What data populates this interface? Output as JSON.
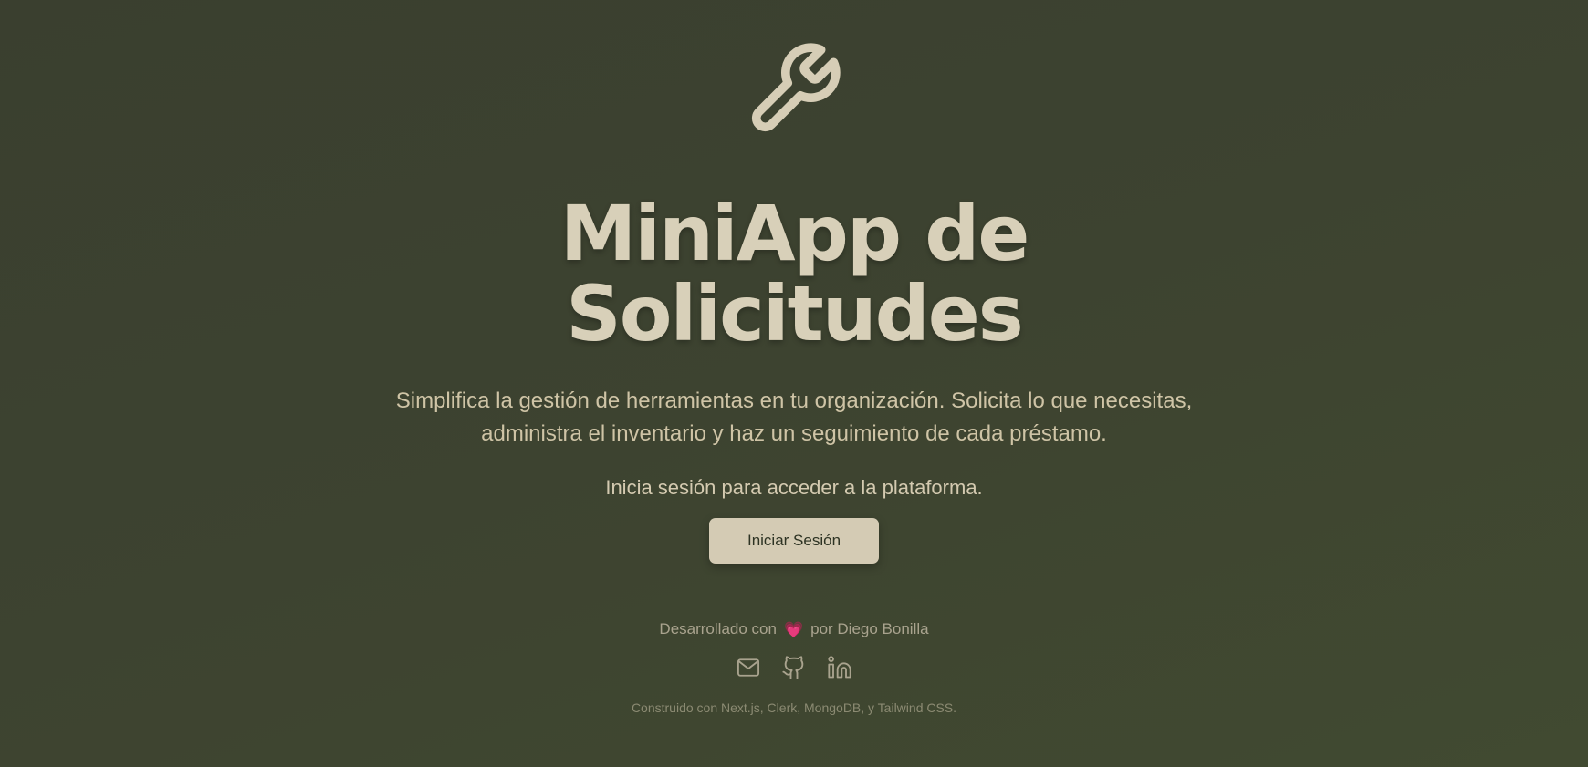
{
  "hero": {
    "logo_icon": "wrench-icon",
    "title_line1": "MiniApp de",
    "title_line2": "Solicitudes",
    "tagline": "Simplifica la gestión de herramientas en tu organización. Solicita lo que necesitas, administra el inventario y haz un seguimiento de cada préstamo.",
    "signin_hint": "Inicia sesión para acceder a la plataforma.",
    "signin_button_label": "Iniciar Sesión"
  },
  "footer": {
    "credit_prefix": "Desarrollado con",
    "credit_icon": "heart-icon",
    "credit_suffix": "por Diego Bonilla",
    "social": [
      {
        "icon": "mail-icon"
      },
      {
        "icon": "github-icon"
      },
      {
        "icon": "linkedin-icon"
      }
    ],
    "built_with": "Construido con Next.js, Clerk, MongoDB, y Tailwind CSS."
  },
  "colors": {
    "background": "#3d4330",
    "accent": "#d6cdb6",
    "button_bg": "#d4cbb4",
    "heart": "#e04a80"
  }
}
